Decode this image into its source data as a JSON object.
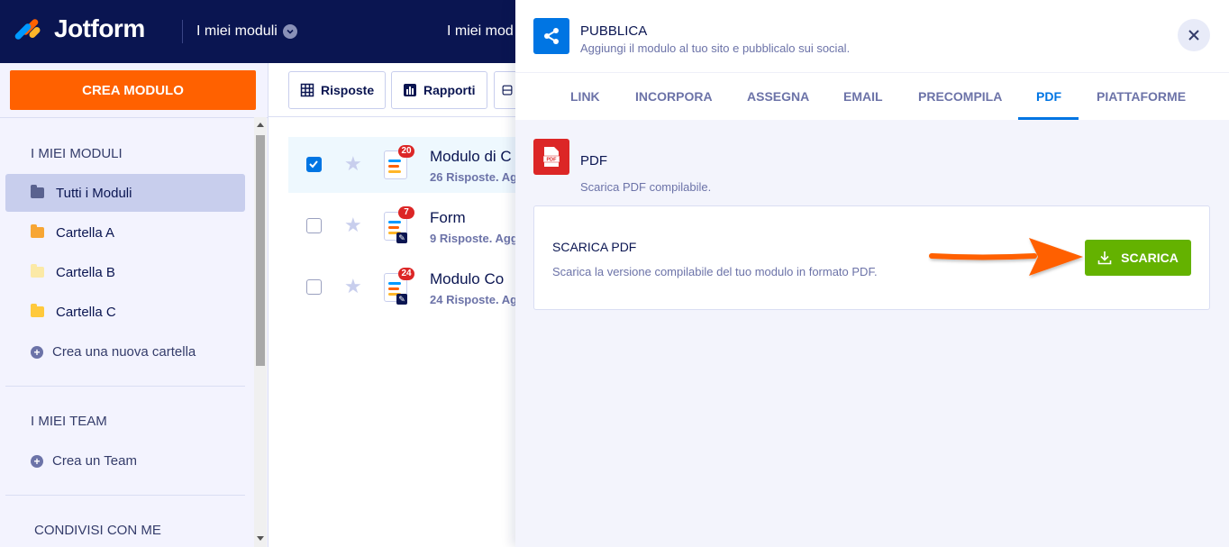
{
  "header": {
    "logo_text": "Jotform",
    "workspace_title": "I miei moduli",
    "secondary_title": "I miei mod"
  },
  "sidebar": {
    "create_button": "CREA MODULO",
    "my_forms_heading": "I MIEI MODULI",
    "folders": [
      {
        "label": "Tutti i Moduli",
        "color": "#5a628f",
        "active": true
      },
      {
        "label": "Cartella A",
        "color": "#f7a634",
        "active": false
      },
      {
        "label": "Cartella B",
        "color": "#fbe9a6",
        "active": false
      },
      {
        "label": "Cartella C",
        "color": "#ffc93c",
        "active": false
      }
    ],
    "new_folder": "Crea una nuova cartella",
    "my_teams_heading": "I MIEI TEAM",
    "new_team": "Crea un Team",
    "shared_heading": "CONDIVISI CON ME"
  },
  "toolbar": {
    "responses_button": "Risposte",
    "reports_button": "Rapporti"
  },
  "forms": [
    {
      "title": "Modulo di C",
      "subtitle": "26 Risposte. Ag",
      "badge": "20",
      "selected": true,
      "edit_marker": false
    },
    {
      "title": "Form",
      "subtitle": "9 Risposte. Agg",
      "badge": "7",
      "selected": false,
      "edit_marker": true
    },
    {
      "title": "Modulo Co",
      "subtitle": "24 Risposte. Ag",
      "badge": "24",
      "selected": false,
      "edit_marker": true
    }
  ],
  "publish_panel": {
    "title": "PUBBLICA",
    "subtitle": "Aggiungi il modulo al tuo sito e pubblicalo sui social.",
    "tabs": [
      "LINK",
      "INCORPORA",
      "ASSEGNA",
      "EMAIL",
      "PRECOMPILA",
      "PDF",
      "PIATTAFORME"
    ],
    "active_tab": "PDF",
    "section_title": "PDF",
    "section_subtitle": "Scarica PDF compilabile.",
    "pdf_icon_label": "PDF",
    "card_title": "SCARICA PDF",
    "card_subtitle": "Scarica la versione compilabile del tuo modulo in formato PDF.",
    "download_button": "SCARICA"
  },
  "colors": {
    "navy": "#0a1551",
    "orange": "#ff6100",
    "blue": "#0075e3",
    "green": "#64b200",
    "red": "#dc2626"
  }
}
